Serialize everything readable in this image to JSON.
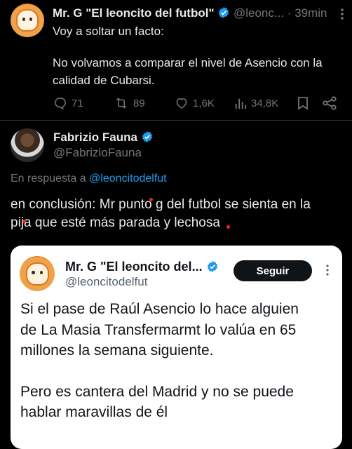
{
  "tweet1": {
    "author_name": "Mr. G \"El leoncito del futbol\"",
    "handle": "@leonc...",
    "separator": "·",
    "time": "39min",
    "line1": "Voy a soltar un facto:",
    "line2": "No volvamos a comparar el nivel de Asencio con la",
    "line3": "calidad de Cubarsi.",
    "replies": "71",
    "retweets": "89",
    "likes": "1,6K",
    "views": "34,8K"
  },
  "tweet2": {
    "author_name": "Fabrizio Fauna",
    "handle": "@FabrizioFauna",
    "reply_prefix": "En respuesta a",
    "reply_to": "@leoncitodelfut",
    "line1": "en conclusión: Mr punto g del futbol se sienta en la",
    "line2": "pija que esté más parada y lechosa"
  },
  "quote": {
    "author_name": "Mr. G \"El leoncito del...",
    "handle": "@leoncitodelfut",
    "follow_label": "Seguir",
    "line1": "Si el pase de Raúl Asencio lo hace alguien",
    "line2": "de La Masia Transfermarmt lo valúa en 65",
    "line3": "millones la semana siguiente.",
    "line4": "Pero es cantera del Madrid y no se puede",
    "line5": "hablar maravillas de él"
  },
  "colors": {
    "background": "#000000",
    "accent": "#1d9bf0",
    "muted": "#71767b"
  }
}
